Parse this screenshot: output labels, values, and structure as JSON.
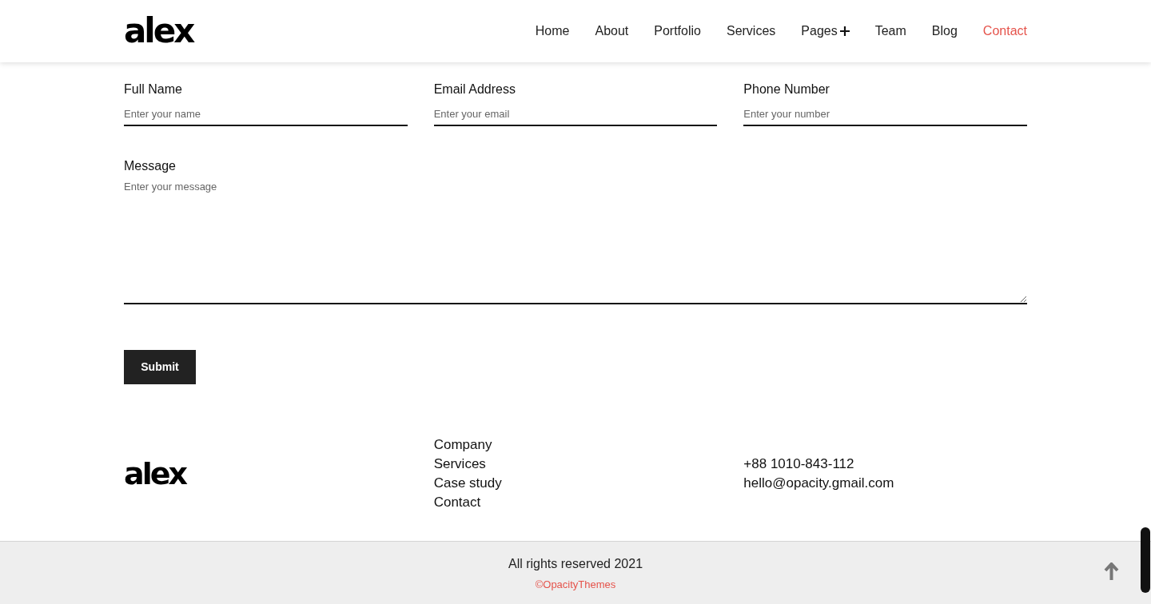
{
  "header": {
    "logo": "alex",
    "nav": [
      {
        "label": "Home",
        "selected": false,
        "kind": "link"
      },
      {
        "label": "About",
        "selected": false,
        "kind": "link"
      },
      {
        "label": "Portfolio",
        "selected": false,
        "kind": "link"
      },
      {
        "label": "Services",
        "selected": false,
        "kind": "link"
      },
      {
        "label": "Pages",
        "selected": false,
        "kind": "dropdown"
      },
      {
        "label": "Team",
        "selected": false,
        "kind": "link"
      },
      {
        "label": "Blog",
        "selected": false,
        "kind": "link"
      },
      {
        "label": "Contact",
        "selected": true,
        "kind": "link"
      }
    ]
  },
  "form": {
    "fields": [
      {
        "label": "Full Name",
        "placeholder": "Enter your name"
      },
      {
        "label": "Email Address",
        "placeholder": "Enter your email"
      },
      {
        "label": "Phone Number",
        "placeholder": "Enter your number"
      }
    ],
    "message": {
      "label": "Message",
      "placeholder": "Enter your message"
    },
    "submit": "Submit"
  },
  "footer": {
    "logo": "alex",
    "links": [
      "Company",
      "Services",
      "Case study",
      "Contact"
    ],
    "contact": [
      "+88 1010-843-112",
      "hello@opacity.gmail.com"
    ]
  },
  "bottom_bar": {
    "copyright": "All rights reserved 2021",
    "credit": "©OpacityThemes"
  }
}
